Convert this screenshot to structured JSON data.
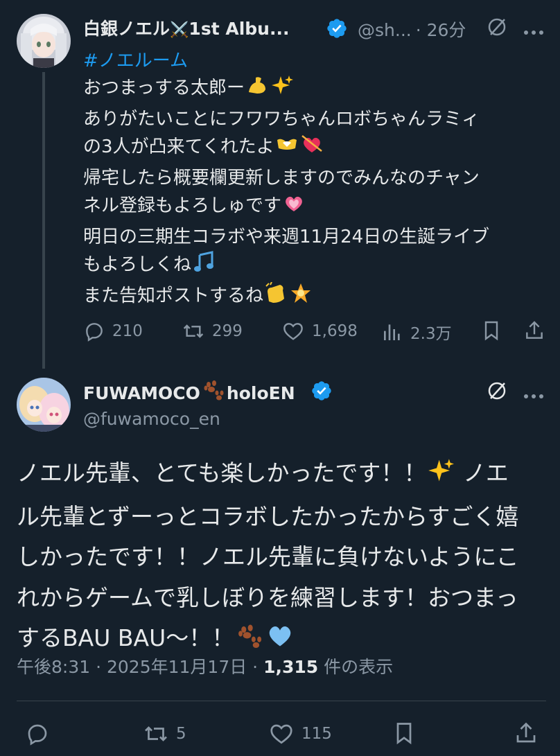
{
  "post1": {
    "display_name": "白銀ノエル",
    "name_emoji": "⚔️",
    "name_suffix": "1st Albu...",
    "handle": "@sh...",
    "time": "· 26分",
    "hashtag": "#ノエルーム",
    "lines": [
      "おつまっする太郎ー",
      "ありがたいことにフワワちゃんロボちゃんラミィ",
      "の3人が凸来てくれたよ",
      "帰宅したら概要欄更新しますのでみんなのチャン",
      "ネル登録もよろしゅです",
      "明日の三期生コラボや来週11月24日の生誕ライブ",
      "もよろしくね",
      "また告知ポストするね"
    ],
    "stats": {
      "replies": "210",
      "reposts": "299",
      "likes": "1,698",
      "views": "2.3万"
    }
  },
  "post2": {
    "display_name": "FUWAMOCO",
    "name_suffix": "holoEN",
    "handle": "@fuwamoco_en",
    "lines": [
      "ノエル先輩、とても楽しかったです！！",
      "ノエ",
      "ル先輩とずーっとコラボしたかったからすごく嬉",
      "しかったです！！ノエル先輩に負けないようにこ",
      "れからゲームで乳しぼりを練習します！おつまっ",
      "するBAU BAU～！！"
    ],
    "time": "午後8:31 · 2025年11月17日 · ",
    "views_count": "1,315",
    "views_label": " 件の表示",
    "stats": {
      "reposts": "5",
      "likes": "115"
    }
  },
  "colors": {
    "background": "#15202b",
    "text": "#e7e9ea",
    "muted": "#8b98a5",
    "accent": "#1d9bf0",
    "divider": "#38444d"
  },
  "icons": [
    "verified-badge-icon",
    "grok-icon",
    "more-icon",
    "reply-icon",
    "repost-icon",
    "like-icon",
    "views-icon",
    "bookmark-icon",
    "share-icon"
  ]
}
